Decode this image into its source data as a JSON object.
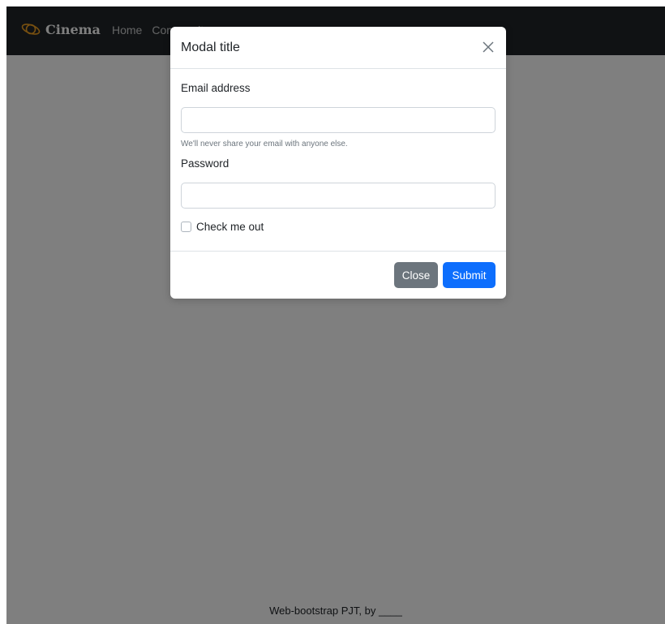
{
  "navbar": {
    "brand": "Cinema",
    "links": [
      "Home",
      "Community"
    ]
  },
  "footer": {
    "text": "Web-bootstrap PJT, by ____"
  },
  "modal": {
    "title": "Modal title",
    "email_label": "Email address",
    "email_value": "",
    "email_help": "We'll never share your email with anyone else.",
    "password_label": "Password",
    "password_value": "",
    "check_label": "Check me out",
    "checked": false,
    "close_label": "Close",
    "submit_label": "Submit"
  },
  "colors": {
    "navbar": "#212529",
    "backdrop": "rgba(0,0,0,0.5)",
    "primary": "#0d6efd",
    "secondary": "#6c757d",
    "logo": "#f0a020"
  },
  "icons": {
    "brand": "planet-icon",
    "close": "close-icon"
  }
}
